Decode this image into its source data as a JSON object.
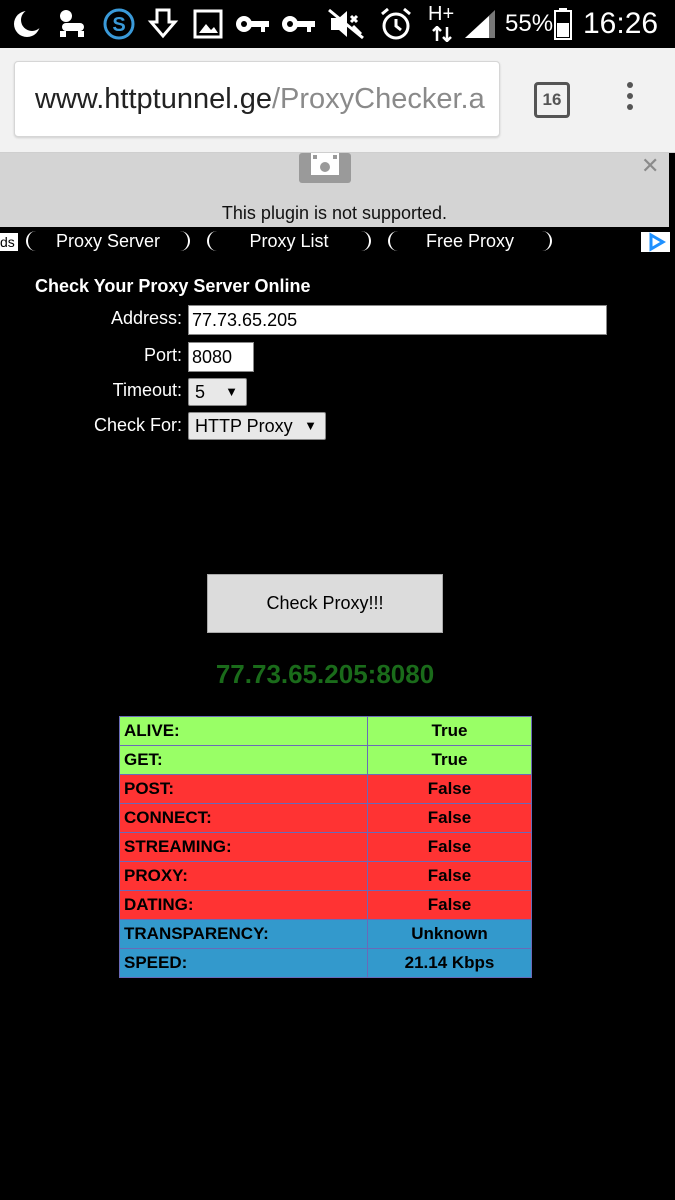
{
  "status_bar": {
    "icons": [
      "moon-icon",
      "baby-icon",
      "s-app-icon",
      "download-icon",
      "image-icon",
      "key-icon",
      "key-icon",
      "mute-icon",
      "alarm-icon",
      "signal-icon",
      "battery-icon"
    ],
    "network": "H+",
    "battery": "55%",
    "time": "16:26"
  },
  "browser": {
    "url_host": "www.httptunnel.ge",
    "url_path": "/ProxyChecker.a",
    "tab_count": "16"
  },
  "plugin_notice": {
    "message": "This plugin is not supported."
  },
  "ad_links": {
    "left_fragment": "ds",
    "items": [
      "Proxy Server",
      "Proxy List",
      "Free Proxy"
    ]
  },
  "form": {
    "title": "Check Your Proxy Server Online",
    "address_label": "Address:",
    "address_value": "77.73.65.205",
    "port_label": "Port:",
    "port_value": "8080",
    "timeout_label": "Timeout:",
    "timeout_value": "5",
    "checkfor_label": "Check For:",
    "checkfor_value": "HTTP Proxy",
    "submit_label": "Check Proxy!!!"
  },
  "result": {
    "address": "77.73.65.205:8080",
    "rows": [
      {
        "label": "ALIVE:",
        "value": "True",
        "color": "#99ff66"
      },
      {
        "label": "GET:",
        "value": "True",
        "color": "#99ff66"
      },
      {
        "label": "POST:",
        "value": "False",
        "color": "#ff3333"
      },
      {
        "label": "CONNECT:",
        "value": "False",
        "color": "#ff3333"
      },
      {
        "label": "STREAMING:",
        "value": "False",
        "color": "#ff3333"
      },
      {
        "label": "PROXY:",
        "value": "False",
        "color": "#ff3333"
      },
      {
        "label": "DATING:",
        "value": "False",
        "color": "#ff3333"
      },
      {
        "label": "TRANSPARENCY:",
        "value": "Unknown",
        "color": "#3399cc"
      },
      {
        "label": "SPEED:",
        "value": "21.14 Kbps",
        "color": "#3399cc"
      }
    ]
  }
}
